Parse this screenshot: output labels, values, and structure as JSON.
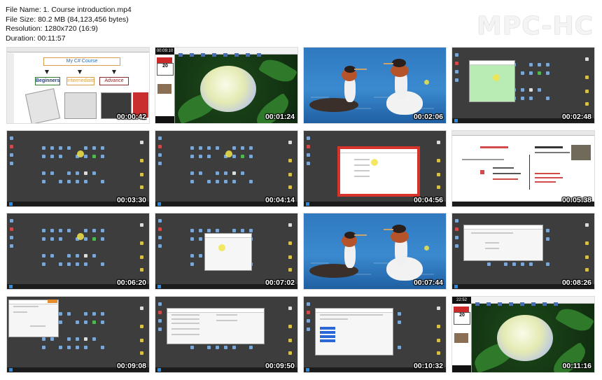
{
  "info": {
    "file_name": "File Name: 1. Course introduction.mp4",
    "file_size": "File Size: 80.2 MB (84,123,456 bytes)",
    "resolution": "Resolution: 1280x720 (16:9)",
    "duration": "Duration: 00:11:57"
  },
  "brand": "MPC-HC",
  "thumbnails": [
    {
      "time": "00:00:42",
      "scene": "diagram"
    },
    {
      "time": "00:01:24",
      "scene": "flower"
    },
    {
      "time": "00:02:06",
      "scene": "lake"
    },
    {
      "time": "00:02:48",
      "scene": "desktop-green"
    },
    {
      "time": "00:03:30",
      "scene": "desktop"
    },
    {
      "time": "00:04:14",
      "scene": "desktop"
    },
    {
      "time": "00:04:56",
      "scene": "desktop-red-window"
    },
    {
      "time": "00:05:38",
      "scene": "document"
    },
    {
      "time": "00:06:20",
      "scene": "desktop"
    },
    {
      "time": "00:07:02",
      "scene": "desktop-window"
    },
    {
      "time": "00:07:44",
      "scene": "lake"
    },
    {
      "time": "00:08:26",
      "scene": "desktop-dialog"
    },
    {
      "time": "00:09:08",
      "scene": "desktop-small-window"
    },
    {
      "time": "00:09:50",
      "scene": "desktop-form"
    },
    {
      "time": "00:10:32",
      "scene": "desktop-list"
    },
    {
      "time": "00:11:16",
      "scene": "flower"
    }
  ],
  "diagram": {
    "title": "My C# Course",
    "beginners": "Beginners",
    "intermediate": "Intermediate",
    "advance": "Advance"
  },
  "panel": {
    "clock_a": "00:09:10",
    "clock_b": "22:52",
    "date": "20"
  }
}
